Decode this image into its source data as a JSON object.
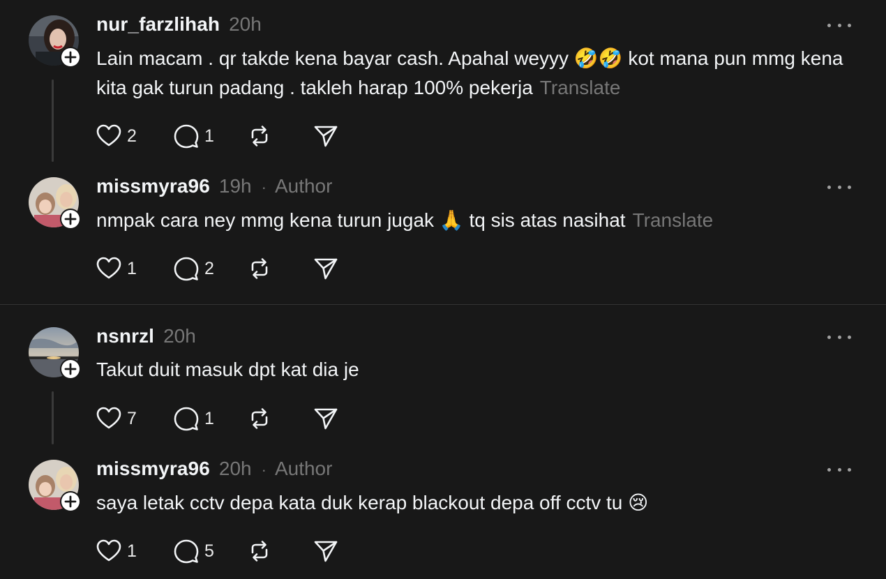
{
  "threads": [
    {
      "comment": {
        "username": "nur_farzlihah",
        "time": "20h",
        "author_tag": "",
        "text": "Lain macam . qr takde kena bayar cash. Apahal weyyy 🤣🤣 kot mana pun mmg kena kita gak turun padang . takleh harap 100% pekerja",
        "translate": "Translate",
        "likes": "2",
        "replies": "1"
      },
      "reply": {
        "username": "missmyra96",
        "time": "19h",
        "dot": "·",
        "author_tag": "Author",
        "text": "nmpak cara ney mmg kena turun jugak 🙏 tq sis atas nasihat",
        "translate": "Translate",
        "likes": "1",
        "replies": "2"
      }
    },
    {
      "comment": {
        "username": "nsnrzl",
        "time": "20h",
        "author_tag": "",
        "text": "Takut duit masuk dpt kat dia je",
        "translate": "",
        "likes": "7",
        "replies": "1"
      },
      "reply": {
        "username": "missmyra96",
        "time": "20h",
        "dot": "·",
        "author_tag": "Author",
        "text": "saya letak cctv depa kata duk kerap blackout depa off cctv tu 😢",
        "translate": "",
        "likes": "1",
        "replies": "5"
      }
    }
  ],
  "icons": {
    "like": "heart-icon",
    "reply": "comment-bubble-icon",
    "repost": "repost-icon",
    "share": "send-icon",
    "more": "more-horizontal-icon",
    "follow": "plus-icon"
  },
  "colors": {
    "background": "#181818",
    "text": "#f3f5f7",
    "muted": "#777777",
    "divider": "#333333"
  }
}
